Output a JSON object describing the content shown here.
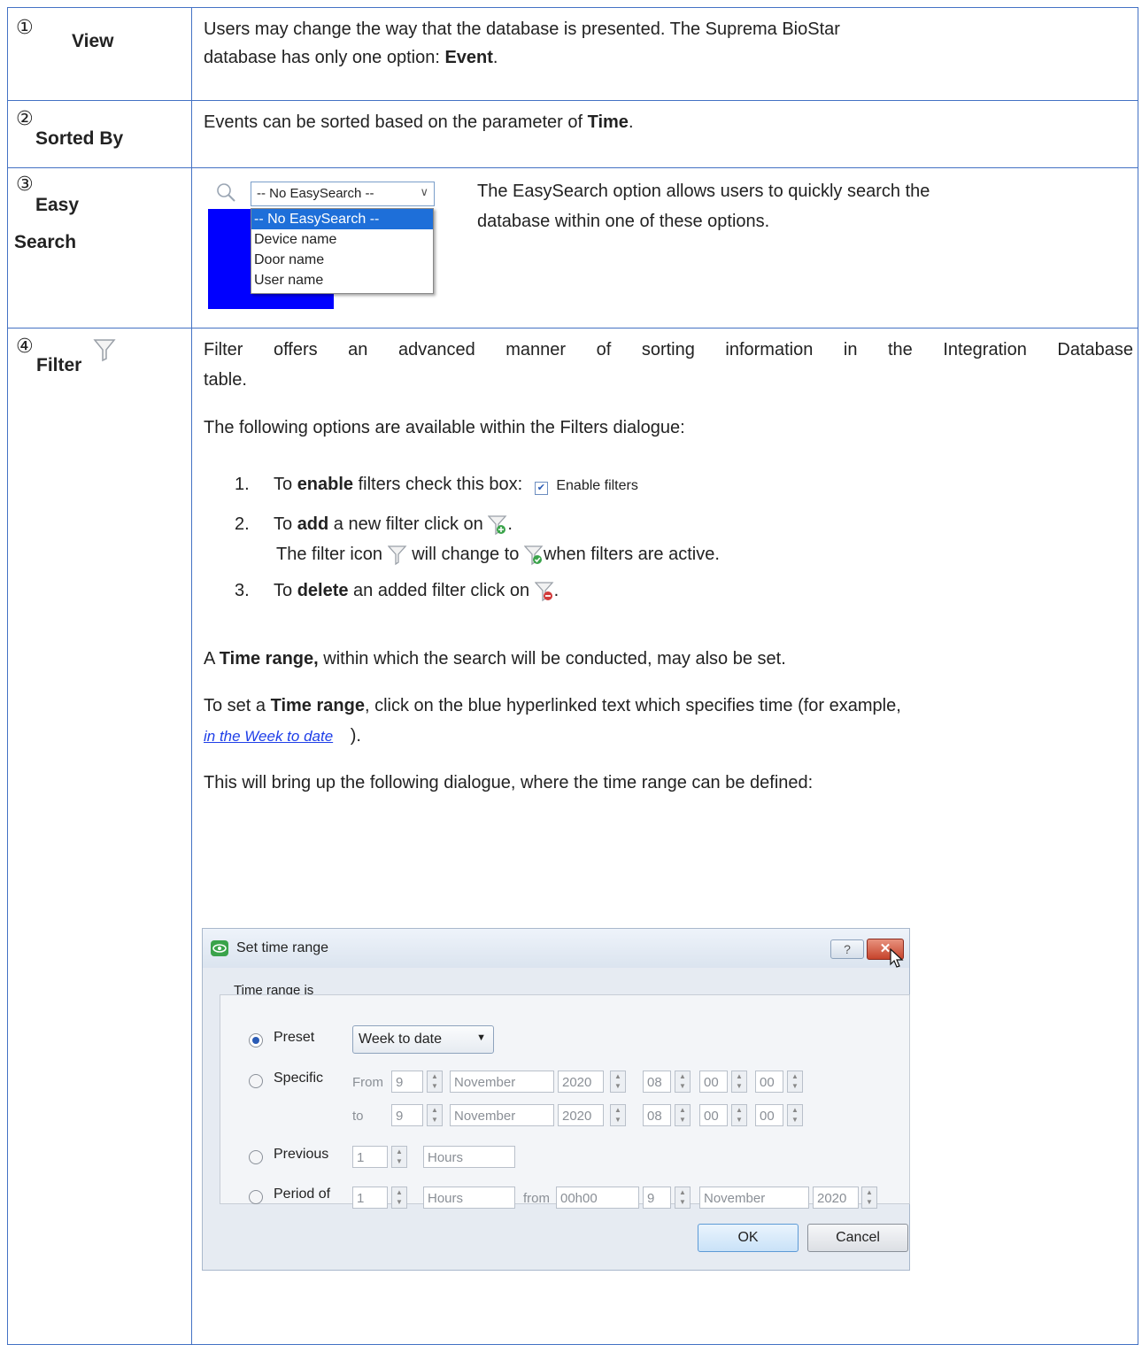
{
  "rows": {
    "view": {
      "number": "①",
      "label": "View",
      "text_a": "Users may change the way that the database is presented. The Suprema BioStar",
      "text_b": "database has only one option: ",
      "text_b_bold": "Event",
      "text_b_end": "."
    },
    "sorted": {
      "number": "②",
      "label": "Sorted By",
      "text": "Events can be sorted based on the parameter of ",
      "text_bold": "Time",
      "text_end": "."
    },
    "easy": {
      "number": "③",
      "label_1": "Easy",
      "label_2": "Search",
      "desc_1": "The EasySearch option allows users to quickly search the",
      "desc_2": "database within one of these options.",
      "dropdown": {
        "selected": "-- No EasySearch --",
        "options": [
          "-- No EasySearch --",
          "Device name",
          "Door name",
          "User name"
        ]
      }
    },
    "filter": {
      "number": "④",
      "label": "Filter",
      "intro_1": "Filter offers an advanced manner of sorting information in the Integration Database",
      "intro_2": "table.",
      "options_intro": "The following options are available within the Filters dialogue:",
      "item1_pre": "To ",
      "item1_bold": "enable",
      "item1_post": " filters check this box:",
      "enable_filters_label": "Enable filters",
      "item2_pre": "To ",
      "item2_bold": "add",
      "item2_post": " a new filter click on",
      "item2_sub_a": "The filter icon",
      "item2_sub_b": "will change to",
      "item2_sub_c": "when filters are active.",
      "item3_pre": "To ",
      "item3_bold": "delete",
      "item3_post": " an added filter click on",
      "time_a": "A ",
      "time_bold": "Time range,",
      "time_post": " within which the search will be conducted, may also be set.",
      "set_pre": "To set a ",
      "set_bold": "Time range",
      "set_post": ", click on the blue hyperlinked text which specifies time (for example,",
      "link_text": "in the Week to date",
      "link_close": ").",
      "bring_up": "This will bring up the following dialogue, where the time range can be defined:"
    }
  },
  "dialog": {
    "title": "Set time range",
    "help": "?",
    "group_label": "Time range is",
    "preset_label": "Preset",
    "preset_value": "Week to date",
    "specific_label": "Specific",
    "from_label": "From",
    "to_label": "to",
    "day": "9",
    "month": "November",
    "year": "2020",
    "hh": "08",
    "mm": "00",
    "ss": "00",
    "previous_label": "Previous",
    "prev_count": "1",
    "prev_unit": "Hours",
    "period_label": "Period of",
    "period_count": "1",
    "period_unit": "Hours",
    "from_word": "from",
    "period_time": "00h00",
    "ok": "OK",
    "cancel": "Cancel"
  },
  "colors": {
    "border": "#4472c4",
    "link": "#1f3fe8",
    "selection": "#1e6fd9",
    "preview_block": "#0000ff"
  }
}
